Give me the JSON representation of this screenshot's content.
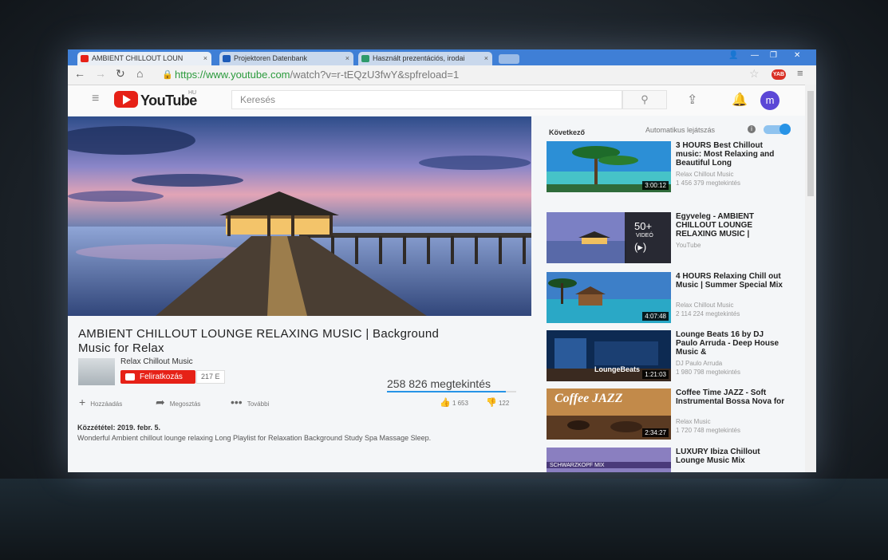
{
  "browser": {
    "tabs": [
      {
        "label": "AMBIENT CHILLOUT LOUN",
        "close": "×"
      },
      {
        "label": "Projektoren Datenbank",
        "close": "×"
      },
      {
        "label": "Használt prezentációs, irodai",
        "close": "×"
      }
    ],
    "url_main": "https://www.youtube.com",
    "url_rest": "/watch?v=r-tEQzU3fwY&spfreload=1",
    "extension_badge": "YAB"
  },
  "youtube": {
    "logo_text": "YouTube",
    "logo_region": "HU",
    "search_placeholder": "Keresés",
    "avatar_letter": "m"
  },
  "video": {
    "title": "AMBIENT CHILLOUT LOUNGE RELAXING MUSIC | Background Music for Relax",
    "channel": "Relax Chillout Music",
    "subscribe_label": "Feliratkozás",
    "subscriber_count": "217 E",
    "views": "258 826 megtekintés",
    "like_ratio": 0.92,
    "actions": {
      "add": "Hozzáadás",
      "share": "Megosztás",
      "more": "További"
    },
    "likes": "1 653",
    "dislikes": "122",
    "published": "Közzététel: 2019. febr. 5.",
    "description": "Wonderful Ambient chillout lounge relaxing Long Playlist for Relaxation Background Study Spa Massage Sleep."
  },
  "sidebar": {
    "next_label": "Következő",
    "autoplay_label": "Automatikus lejátszás",
    "autoplay_on": true,
    "items": [
      {
        "title": "3 HOURS Best Chillout music: Most Relaxing and Beautiful Long",
        "channel": "Relax Chillout Music",
        "views": "1 456 379 megtekintés",
        "duration": "3:00:12"
      },
      {
        "title": "Egyveleg - AMBIENT CHILLOUT LOUNGE RELAXING MUSIC |",
        "channel": "YouTube",
        "views": "",
        "duration": "",
        "mix_count": "50+",
        "mix_label": "VIDEÓ"
      },
      {
        "title": "4 HOURS Relaxing Chill out Music | Summer Special Mix",
        "channel": "Relax Chillout Music",
        "views": "2 114 224 megtekintés",
        "duration": "4:07:48"
      },
      {
        "title": "Lounge Beats 16 by DJ Paulo Arruda - Deep House Music &",
        "channel": "DJ Paulo Arruda",
        "views": "1 980 798 megtekintés",
        "duration": "1:21:03",
        "thumb_text": "LoungeBeats"
      },
      {
        "title": "Coffee Time JAZZ - Soft Instrumental Bossa Nova for",
        "channel": "Relax Music",
        "views": "1 720 748 megtekintés",
        "duration": "2:34:27",
        "thumb_text": "Coffee JAZZ"
      },
      {
        "title": "LUXURY Ibiza Chillout Lounge Music Mix",
        "channel": "",
        "views": "",
        "duration": "",
        "thumb_text": "SCHWARZKOPF MIX"
      }
    ]
  }
}
